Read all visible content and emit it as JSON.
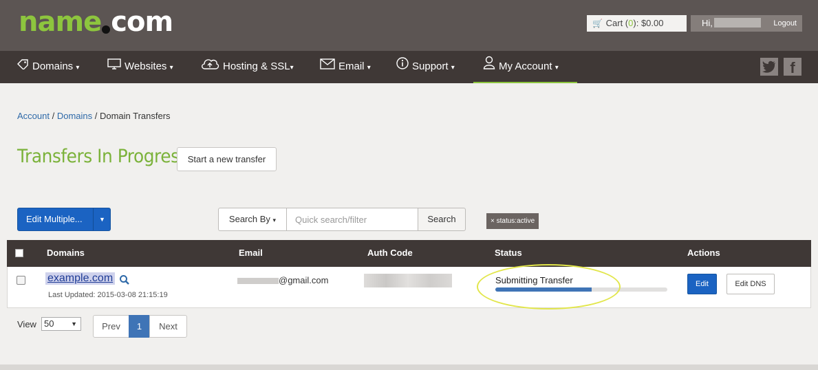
{
  "header": {
    "logo": {
      "name": "name",
      "rest": "com"
    },
    "cart": {
      "label": "Cart (",
      "count": "0",
      "suffix": "):",
      "total": "$0.00"
    },
    "user": {
      "greeting": "Hi,",
      "logout": "Logout"
    }
  },
  "nav": {
    "items": [
      {
        "label": "Domains",
        "icon": "tag-icon",
        "caret": "▾"
      },
      {
        "label": "Websites",
        "icon": "monitor-icon",
        "caret": "▾"
      },
      {
        "label": "Hosting & SSL",
        "icon": "cloud-icon",
        "caret": "▾"
      },
      {
        "label": "Email",
        "icon": "envelope-icon",
        "caret": "▾"
      },
      {
        "label": "Support",
        "icon": "info-icon",
        "caret": "▾"
      },
      {
        "label": "My Account",
        "icon": "user-icon",
        "caret": "▾"
      }
    ],
    "social": {
      "twitter": "twitter-icon",
      "facebook": "facebook-icon"
    }
  },
  "breadcrumb": {
    "items": [
      "Account",
      "Domains"
    ],
    "current": "Domain Transfers",
    "separator": " / "
  },
  "page": {
    "title": "Transfers In Progress",
    "start_transfer": "Start a new transfer"
  },
  "controls": {
    "edit_multiple": "Edit Multiple...",
    "search_by": "Search By",
    "search_placeholder": "Quick search/filter",
    "search_button": "Search",
    "filter_tag": "× status:active"
  },
  "table": {
    "columns": [
      "Domains",
      "Email",
      "Auth Code",
      "Status",
      "Actions"
    ],
    "rows": [
      {
        "domain": "example.com",
        "last_updated": "Last Updated: 2015-03-08 21:15:19",
        "email_domain": "@gmail.com",
        "status": "Submitting Transfer",
        "progress": 0.56,
        "actions": {
          "edit": "Edit",
          "edit_dns": "Edit DNS"
        }
      }
    ]
  },
  "pagination": {
    "view_label": "View",
    "page_size": "50",
    "prev": "Prev",
    "current": "1",
    "next": "Next"
  },
  "colors": {
    "brand_green": "#8dc53e",
    "nav_bg": "#3f3836",
    "header_bg": "#5c5553",
    "primary_blue": "#1b63c2",
    "highlight_ellipse": "#e2e64b"
  }
}
